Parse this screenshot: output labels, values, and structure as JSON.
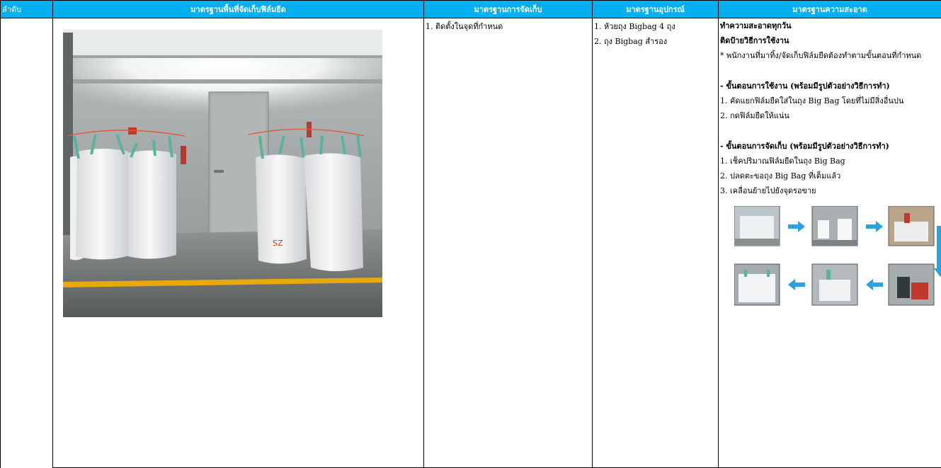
{
  "headers": {
    "no": "ลำดับ",
    "area": "มาตรฐานพื้นที่จัดเก็บฟิล์มยืด",
    "storage": "มาตรฐานการจัดเก็บ",
    "equipment": "มาตรฐานอุปกรณ์",
    "cleanliness": "มาตรฐานความสะอาด"
  },
  "storage_lines": [
    "1. ติดตั้งในจุดที่กำหนด"
  ],
  "equipment_lines": [
    "1. ห้วยถุง Bigbag 4 ถุง",
    "2. ถุง Bigbag สำรอง"
  ],
  "cleanliness": {
    "line1": "ทำความสะอาดทุกวัน",
    "line2": "ติดป้ายวิธีการใช้งาน",
    "line3": "* พนักงานที่มาทิ้ง/จัดเก็บฟิล์มยืดต้องทำตามขั้นตอนที่กำหนด",
    "usage_heading": " - ขั้นตอนการใช้งาน  (พร้อมมีรูปตัวอย่างวิธีการทำ)",
    "usage_steps": [
      "1. คัดแยกฟิล์มยืดใส่ในถุง Big Bag โดยที่ไม่มีสิ่งอื่นปน",
      "2. กดฟิล์มยืดให้แน่น"
    ],
    "store_heading": " - ขั้นตอนการจัดเก็บ (พร้อมมีรูปตัวอย่างวิธีการทำ)",
    "store_steps": [
      "1. เช็คปริมาณฟิล์มยืดในถุง Big Bag",
      "2. ปลดตะขอถุง Big Bag ที่เต็มแล้ว",
      "3. เคลื่อนย้ายไปยังจุดรอขาย"
    ]
  },
  "colors": {
    "header_bg": "#00b0f0",
    "header_text": "#ffffff",
    "arrow": "#29a3dd",
    "floor_line": "#f0b400"
  }
}
